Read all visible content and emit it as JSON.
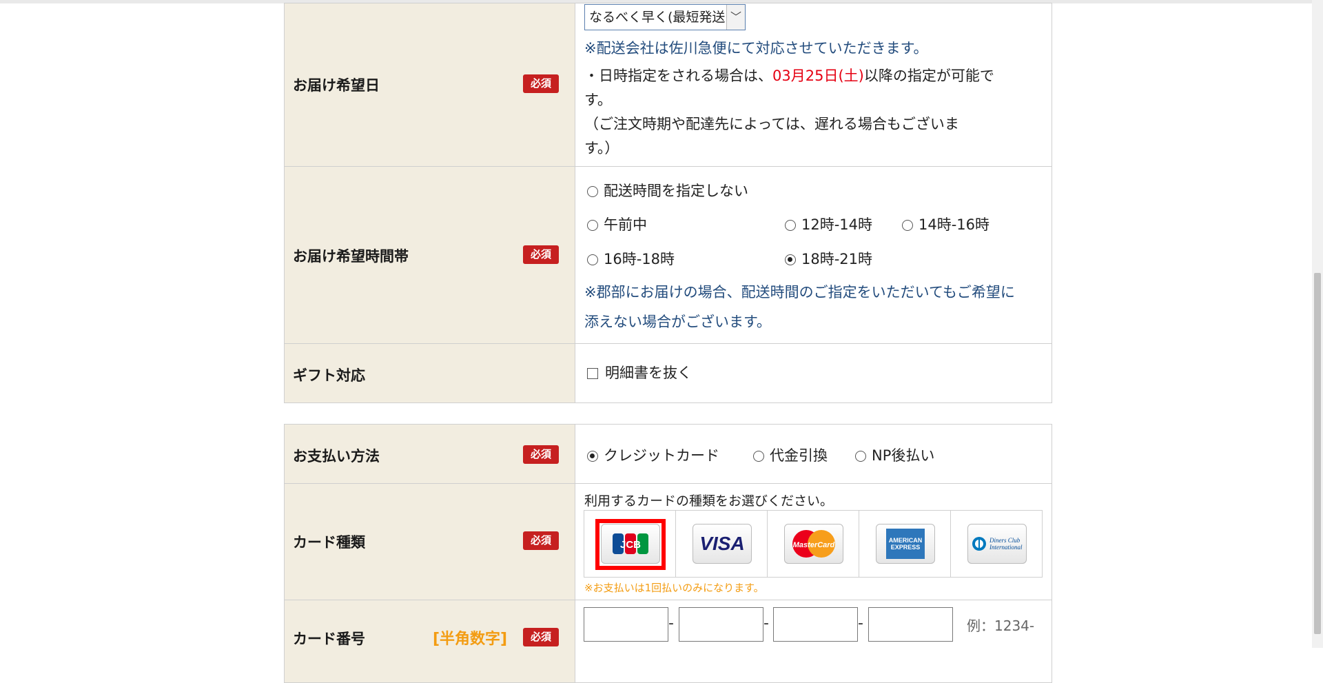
{
  "req_badge": "必須",
  "delivery_date": {
    "label": "お届け希望日",
    "select_value": "なるべく早く(最短発送)",
    "note_carrier": "※配送会社は佐川急便にて対応させていただきます。",
    "note_date_pre": "・日時指定をされる場合は、",
    "note_date_highlight": "03月25日(土)",
    "note_date_post": "以降の指定が可能で",
    "note_date_wrap": "す。",
    "note_delay_1": "（ご注文時期や配達先によっては、遅れる場合もございま",
    "note_delay_2": "す。）"
  },
  "delivery_time": {
    "label": "お届け希望時間帯",
    "options": {
      "none": "配送時間を指定しない",
      "morning": "午前中",
      "t12_14": "12時-14時",
      "t14_16": "14時-16時",
      "t16_18": "16時-18時",
      "t18_21": "18時-21時"
    },
    "selected": "18時-21時",
    "note_1": "※郡部にお届けの場合、配送時間のご指定をいただいてもご希望に",
    "note_2": "添えない場合がございます。"
  },
  "gift": {
    "label": "ギフト対応",
    "checkbox_label": "明細書を抜く"
  },
  "payment": {
    "label": "お支払い方法",
    "options": {
      "credit": "クレジットカード",
      "cod": "代金引換",
      "np": "NP後払い"
    },
    "selected": "クレジットカード"
  },
  "card_type": {
    "label": "カード種類",
    "instruction": "利用するカードの種類をお選びください。",
    "cards": {
      "jcb": "JCB",
      "visa": "VISA",
      "mastercard": "MasterCard",
      "amex": "AMERICAN EXPRESS",
      "diners": "Diners Club International"
    },
    "selected": "JCB",
    "note": "※お支払いは1回払いのみになります。"
  },
  "card_number": {
    "label": "カード番号",
    "hint": "[半角数字]",
    "example": "例：1234-"
  },
  "colors": {
    "header_bg": "#f2ede0",
    "required_red": "#c62020",
    "note_blue": "#234c7d",
    "highlight_red": "#e50012",
    "hint_orange": "#f39c12"
  }
}
